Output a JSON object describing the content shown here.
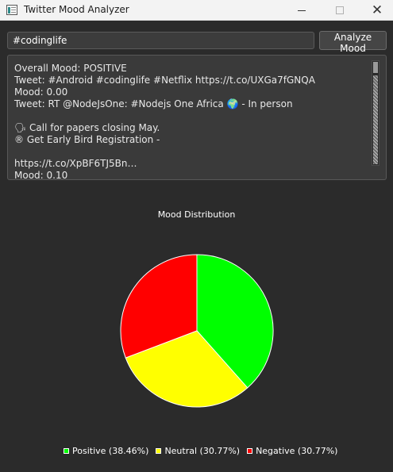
{
  "window": {
    "title": "Twitter Mood Analyzer",
    "icon": "app-window-icon",
    "controls": [
      "minimize-icon",
      "maximize-icon",
      "close-icon"
    ]
  },
  "search": {
    "value": "#codinglife",
    "button_label": "Analyze Mood"
  },
  "results": {
    "lines": [
      "Overall Mood: POSITIVE",
      "Tweet: #Android #codinglife #Netflix https://t.co/UXGa7fGNQA",
      "Mood: 0.00",
      "Tweet: RT @NodeJsOne: #Nodejs One Africa 🌍 - In person",
      "",
      "🗣 Call for papers closing May.",
      "® Get Early Bird Registration -",
      "",
      "https://t.co/XpBF6TJ5Bn…",
      "Mood: 0.10"
    ]
  },
  "colors": {
    "background": "#2b2b2b",
    "positive": "#00ff00",
    "neutral": "#ffff00",
    "negative": "#ff0000"
  },
  "chart_data": {
    "type": "pie",
    "title": "Mood Distribution",
    "categories": [
      "Positive",
      "Neutral",
      "Negative"
    ],
    "values": [
      38.46,
      30.77,
      30.77
    ],
    "legend_labels": [
      "Positive (38.46%)",
      "Neutral (30.77%)",
      "Negative (30.77%)"
    ],
    "colors": [
      "#00ff00",
      "#ffff00",
      "#ff0000"
    ],
    "legend_position": "bottom"
  }
}
